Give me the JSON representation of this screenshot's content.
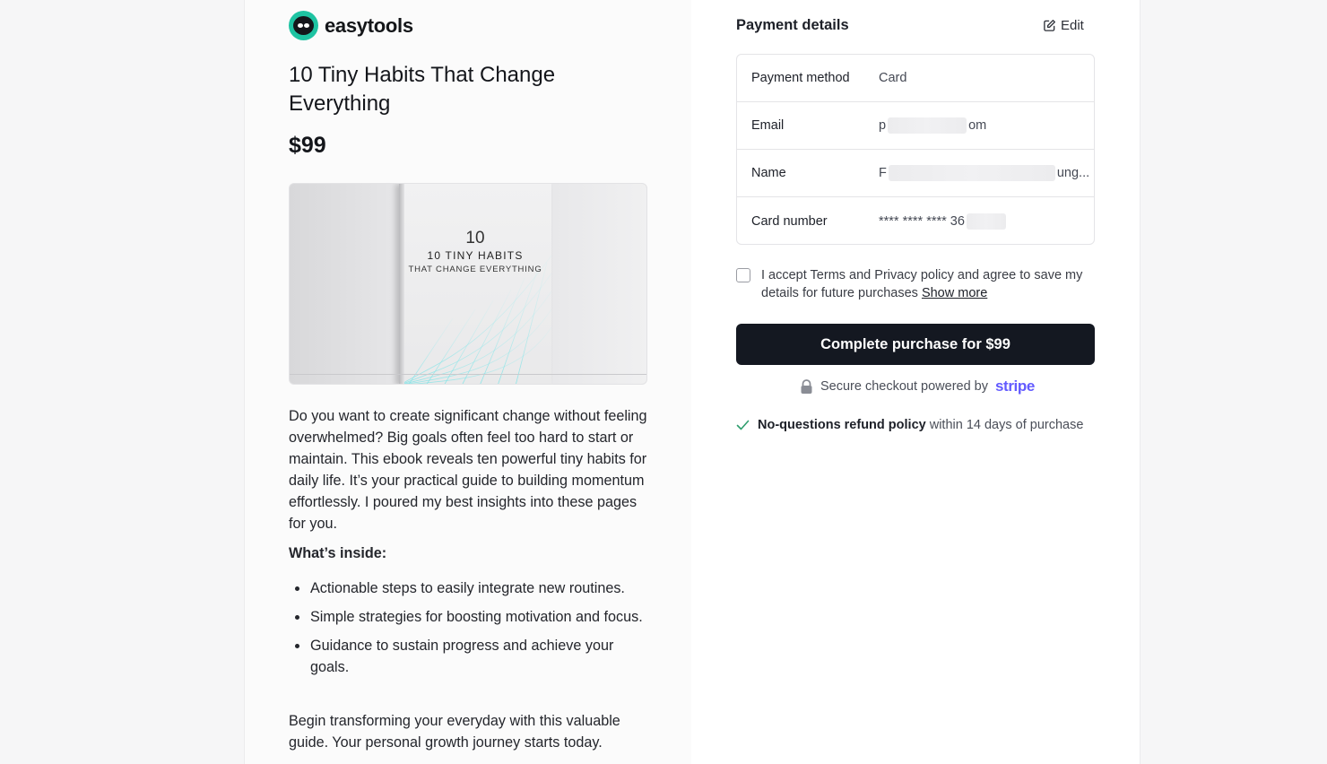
{
  "brand": {
    "name": "easytools"
  },
  "product": {
    "title": "10 Tiny Habits That Change Everything",
    "price": "$99",
    "cover": {
      "number": "10",
      "line1": "10 TINY HABITS",
      "line2": "THAT CHANGE EVERYTHING"
    },
    "description": "Do you want to create significant change without feeling overwhelmed? Big goals often feel too hard to start or maintain. This ebook reveals ten powerful tiny habits for daily life. It’s your practical guide to building momentum effortlessly. I poured my best insights into these pages for you.",
    "inside_heading": "What’s inside:",
    "inside_items": [
      "Actionable steps to easily integrate new routines.",
      "Simple strategies for boosting motivation and focus.",
      "Guidance to sustain progress and achieve your goals."
    ],
    "closing": "Begin transforming your everyday with this valuable guide. Your personal growth journey starts today."
  },
  "payment": {
    "title": "Payment details",
    "edit_label": "Edit",
    "rows": [
      {
        "label": "Payment method",
        "value": "Card"
      },
      {
        "label": "Email",
        "value_start": "p",
        "value_end": "om"
      },
      {
        "label": "Name",
        "value_start": "F",
        "value_end": "ung..."
      },
      {
        "label": "Card number",
        "value_start": "**** **** **** 36",
        "value_end": ""
      }
    ],
    "consent": {
      "text": "I accept Terms and Privacy policy and agree to save my details for future purchases",
      "show_more": "Show more",
      "checked": false
    },
    "button_label": "Complete purchase for $99",
    "secure_text": "Secure checkout powered by",
    "stripe_label": "stripe",
    "refund_bold": "No-questions refund policy",
    "refund_rest": "within 14 days of purchase"
  },
  "colors": {
    "brand_teal": "#1ec3a2",
    "button_bg": "#141821",
    "stripe_purple": "#635bff",
    "check_green": "#2f9e6e"
  },
  "icons": [
    "sloth-logo-icon",
    "edit-icon",
    "lock-icon",
    "check-icon"
  ]
}
